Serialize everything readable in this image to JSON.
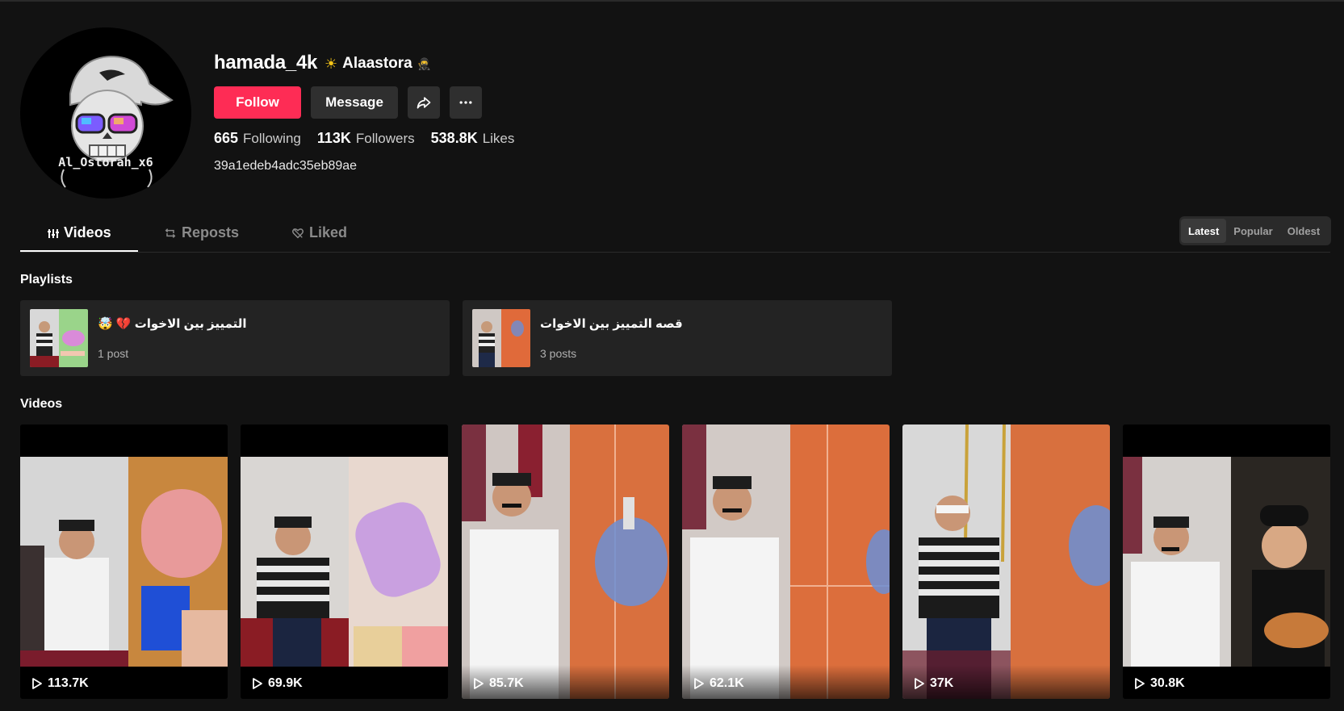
{
  "profile": {
    "username": "hamada_4k",
    "nickname": "Alaastora",
    "avatar_text": "Al_Ostorah_x6",
    "bio": "39a1edeb4adc35eb89ae"
  },
  "buttons": {
    "follow": "Follow",
    "message": "Message"
  },
  "stats": [
    {
      "value": "665",
      "label": "Following"
    },
    {
      "value": "113K",
      "label": "Followers"
    },
    {
      "value": "538.8K",
      "label": "Likes"
    }
  ],
  "tabs": [
    {
      "label": "Videos",
      "icon": "bars-icon",
      "active": true
    },
    {
      "label": "Reposts",
      "icon": "repost-icon",
      "active": false
    },
    {
      "label": "Liked",
      "icon": "heart-icon",
      "active": false
    }
  ],
  "sort": [
    "Latest",
    "Popular",
    "Oldest"
  ],
  "sections": {
    "playlists": "Playlists",
    "videos": "Videos"
  },
  "playlists": [
    {
      "title": "التمييز بين الاخوات 💔 🤯",
      "count": "1 post"
    },
    {
      "title": "قصه التمييز بين الاخوات",
      "count": "3 posts"
    }
  ],
  "videos": [
    {
      "views": "113.7K"
    },
    {
      "views": "69.9K"
    },
    {
      "views": "85.7K"
    },
    {
      "views": "62.1K"
    },
    {
      "views": "37K"
    },
    {
      "views": "30.8K"
    }
  ],
  "colors": {
    "accent": "#fe2c55",
    "background": "#121212",
    "button_dark": "#2f2f2f"
  }
}
